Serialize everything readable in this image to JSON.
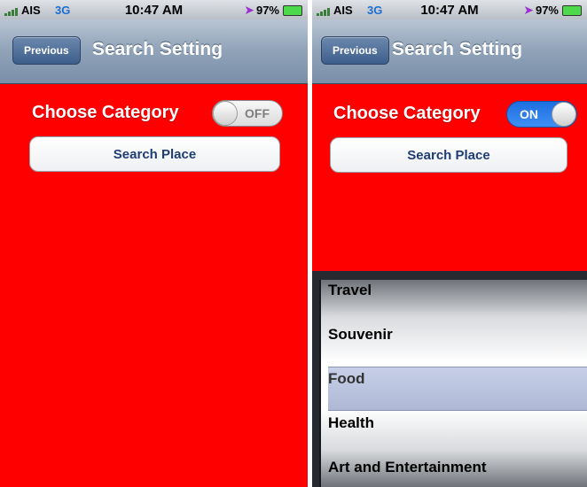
{
  "status": {
    "carrier": "AIS",
    "network": "3G",
    "time": "10:47 AM",
    "battery_left": "97%",
    "battery_right": "97%"
  },
  "nav": {
    "back_label": "Previous",
    "title": "Search Setting"
  },
  "form": {
    "category_label": "Choose Category",
    "search_button": "Search Place"
  },
  "switches": {
    "left_state": "OFF",
    "right_state": "ON"
  },
  "picker": {
    "items": [
      "Travel",
      "Souvenir",
      "Food",
      "Health",
      "Art and Entertainment"
    ],
    "selected": "Food"
  },
  "colors": {
    "background": "#ff0000",
    "switch_on": "#2a7ce8",
    "nav": "#8fa2b8"
  }
}
